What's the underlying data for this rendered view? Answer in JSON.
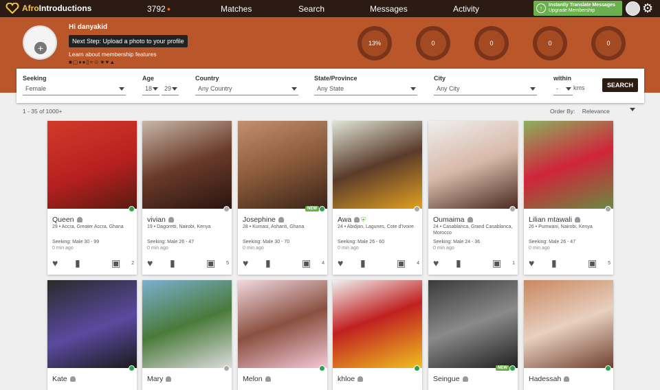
{
  "nav": {
    "logo_prefix": "Afro",
    "logo_suffix": "Introductions",
    "counter": "3792",
    "matches": "Matches",
    "search": "Search",
    "messages": "Messages",
    "activity": "Activity",
    "translate_line1": "Instantly Translate Messages",
    "translate_line2": "Upgrade Membership"
  },
  "banner": {
    "greeting": "Hi danyakid",
    "next_step": "Next Step: Upload a photo to your profile",
    "learn": "Learn about membership features",
    "stats": [
      {
        "value": "13%",
        "icon": "progress-ring-icon"
      },
      {
        "value": "0",
        "icon": "mail-icon"
      },
      {
        "value": "0",
        "icon": "heart-icon"
      },
      {
        "value": "0",
        "icon": "eye-icon"
      },
      {
        "value": "0",
        "icon": "star-icon"
      }
    ]
  },
  "filters": {
    "seeking_label": "Seeking",
    "seeking_value": "Female",
    "age_label": "Age",
    "age_min": "18",
    "age_max": "29",
    "country_label": "Country",
    "country_value": "Any Country",
    "state_label": "State/Province",
    "state_value": "Any State",
    "city_label": "City",
    "city_value": "Any City",
    "within_label": "within",
    "within_value": "-",
    "within_unit": "kms",
    "search_button": "SEARCH"
  },
  "results": {
    "count": "1 - 35 of 1000+",
    "order_label": "Order By:",
    "order_value": "Relevance"
  },
  "colors": {
    "online": "#2ea44f",
    "offline": "#aaaaaa",
    "accent": "#b9562a"
  },
  "profiles": [
    {
      "name": "Queen",
      "details": "29 • Accra, Greater Accra, Ghana",
      "seeking": "Seeking: Male 30 - 99",
      "ago": "0 min ago",
      "photos": "2",
      "status": "online",
      "new": ""
    },
    {
      "name": "vivian",
      "details": "19 • Dagoretti, Nairobi, Kenya",
      "seeking": "Seeking: Male 26 - 47",
      "ago": "0 min ago",
      "photos": "5",
      "status": "offline",
      "new": ""
    },
    {
      "name": "Josephine",
      "details": "28 • Kumasi, Ashanti, Ghana",
      "seeking": "Seeking: Male 30 - 70",
      "ago": "0 min ago",
      "photos": "4",
      "status": "online",
      "new": "NEW"
    },
    {
      "name": "Awa",
      "details": "24 • Abidjan, Lagunes, Cote d'Ivoire",
      "seeking": "Seeking: Male 26 - 60",
      "ago": "0 min ago",
      "photos": "4",
      "status": "offline",
      "new": ""
    },
    {
      "name": "Oumaima",
      "details": "24 • Casablanca, Grand Casablanca, Morocco",
      "seeking": "Seeking: Male 24 - 36",
      "ago": "0 min ago",
      "photos": "1",
      "status": "offline",
      "new": ""
    },
    {
      "name": "Lilian mtawali",
      "details": "26 • Pumwani, Nairobi, Kenya",
      "seeking": "Seeking: Male 26 - 47",
      "ago": "0 min ago",
      "photos": "5",
      "status": "offline",
      "new": ""
    },
    {
      "name": "Kate",
      "status": "online",
      "new": ""
    },
    {
      "name": "Mary",
      "status": "offline",
      "new": ""
    },
    {
      "name": "Melon",
      "status": "online",
      "new": ""
    },
    {
      "name": "khloe",
      "status": "online",
      "new": ""
    },
    {
      "name": "Seingue",
      "status": "online",
      "new": "NEW"
    },
    {
      "name": "Hadessah",
      "status": "online",
      "new": ""
    }
  ]
}
